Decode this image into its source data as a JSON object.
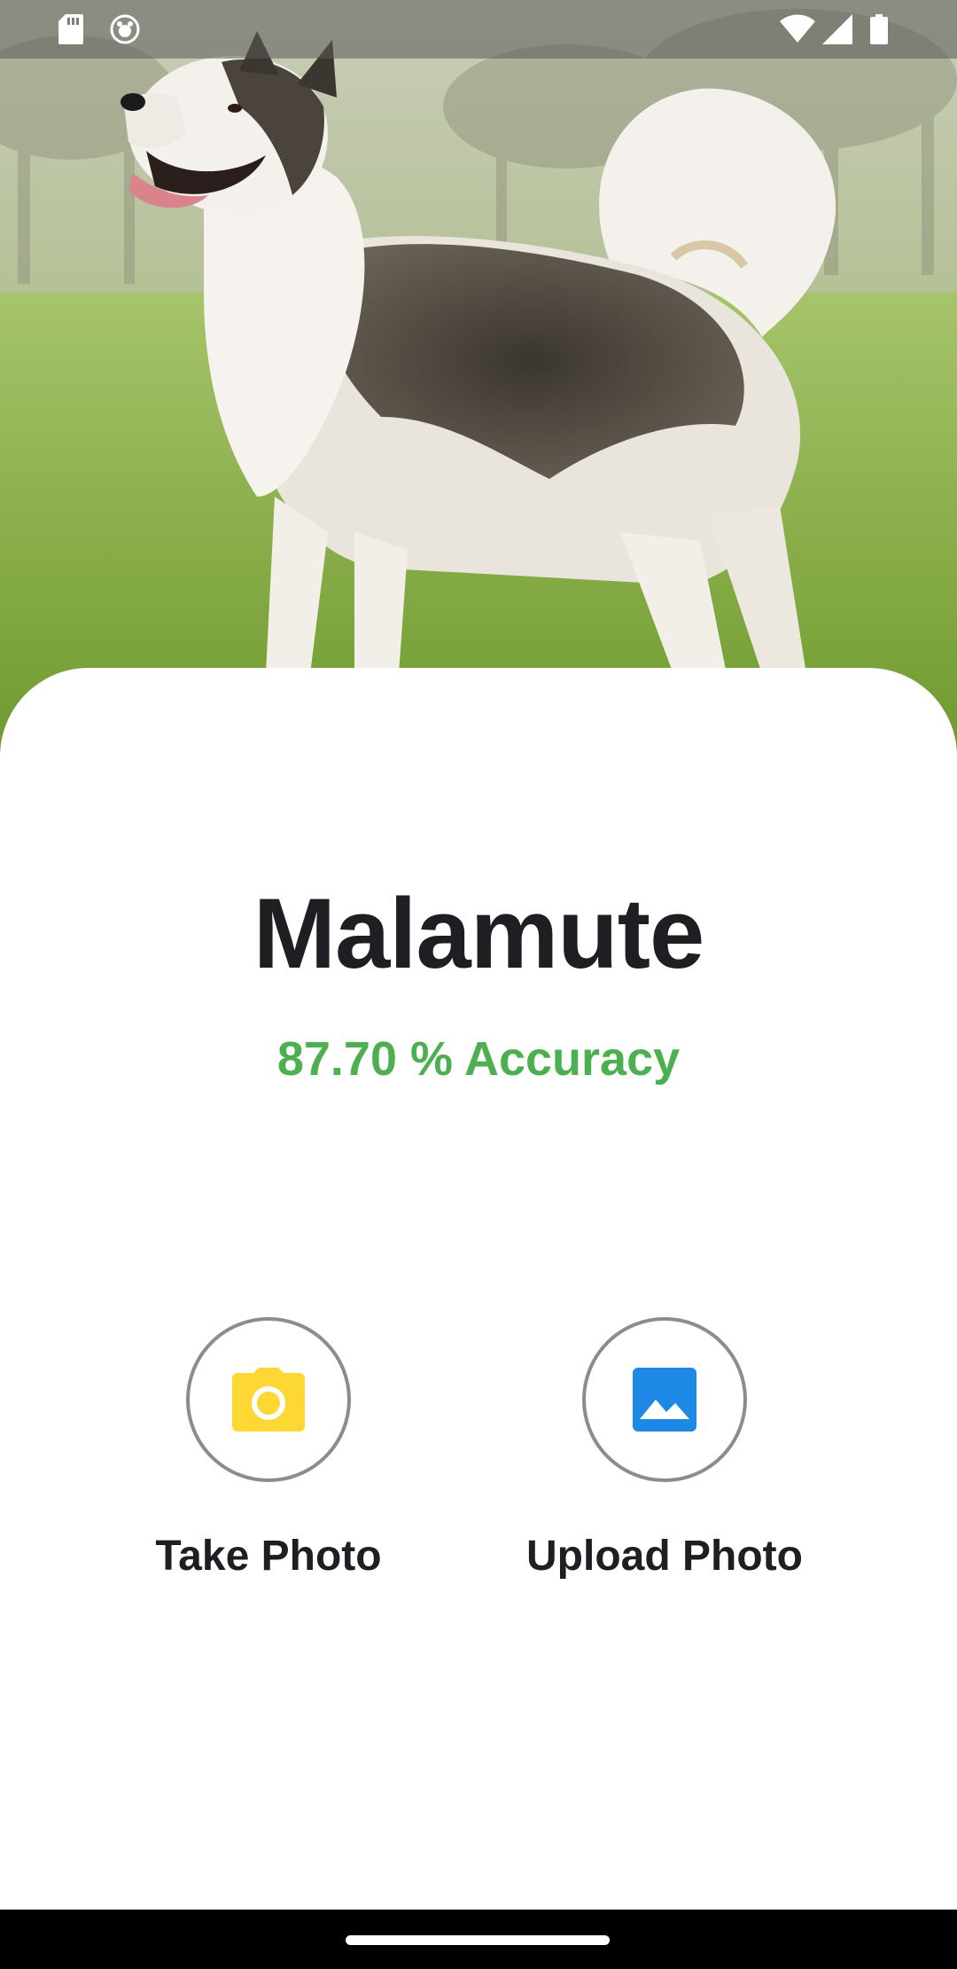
{
  "app": {
    "hero_image_icon": "dog-photo",
    "breed_name": "Malamute",
    "accuracy_text": "87.70 % Accuracy"
  },
  "actions": [
    {
      "label": "Take Photo",
      "icon": "camera-icon",
      "icon_color": "#fdd835"
    },
    {
      "label": "Upload Photo",
      "icon": "image-icon",
      "icon_color": "#1e88e5"
    }
  ],
  "status_bar": {
    "left_icons": [
      "sd-card-icon",
      "app-notification-icon"
    ],
    "right_icons": [
      "wifi-icon",
      "signal-icon",
      "battery-icon"
    ]
  },
  "colors": {
    "accent_green": "#4caf50",
    "text_dark": "#1f1f23",
    "circle_border": "#8c8c8c"
  }
}
